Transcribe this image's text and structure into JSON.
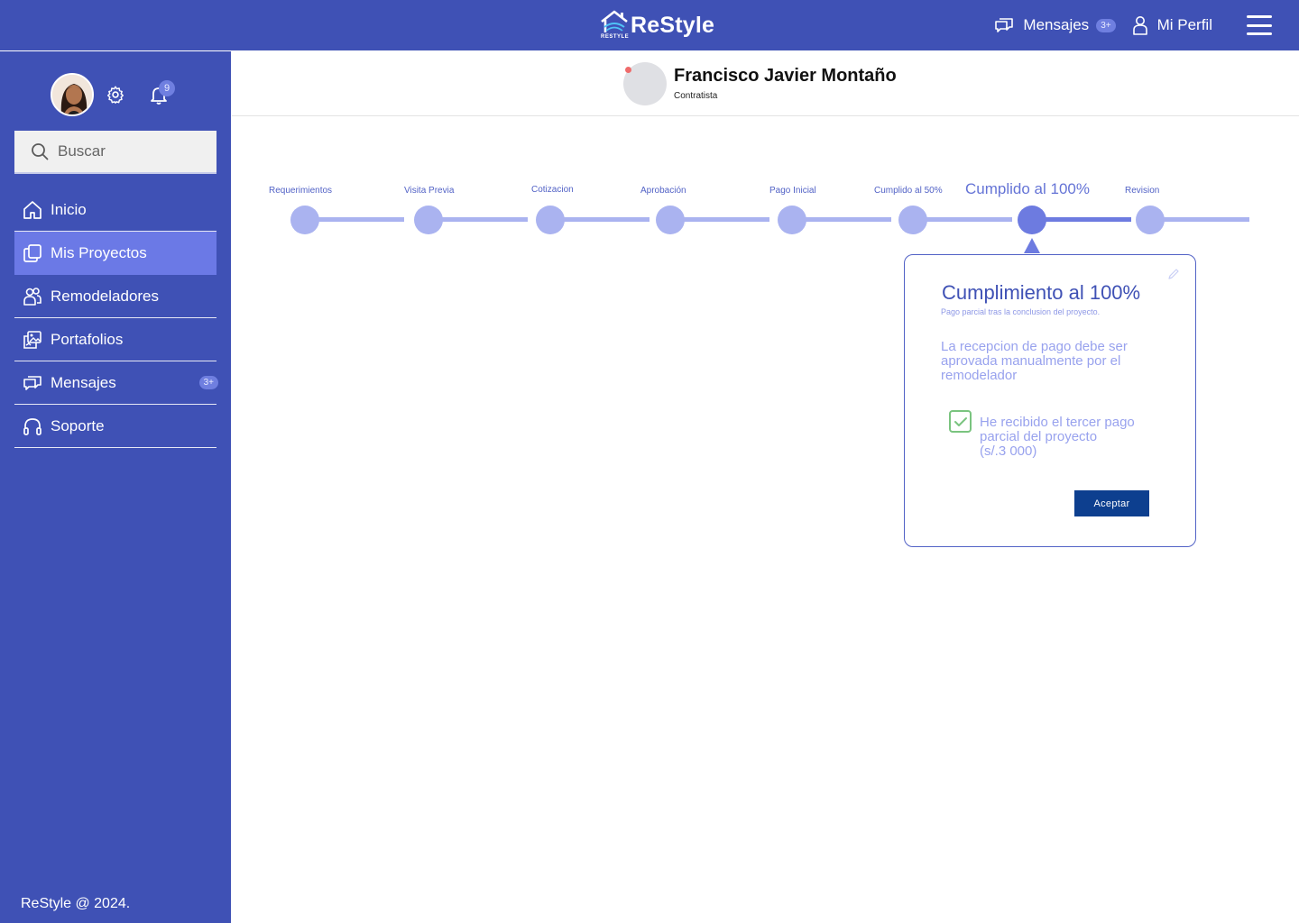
{
  "brand": {
    "name": "ReStyle",
    "sub": "RESTYLE"
  },
  "topnav": {
    "messages_label": "Mensajes",
    "messages_badge": "3+",
    "profile_label": "Mi Perfil"
  },
  "sidebar": {
    "notifications_count": "9",
    "search_placeholder": "Buscar",
    "items": [
      {
        "label": "Inicio",
        "icon": "home-icon"
      },
      {
        "label": "Mis Proyectos",
        "icon": "folders-icon",
        "active": true
      },
      {
        "label": "Remodeladores",
        "icon": "users-icon"
      },
      {
        "label": "Portafolios",
        "icon": "portfolio-icon"
      },
      {
        "label": "Mensajes",
        "icon": "chat-icon",
        "badge": "3+"
      },
      {
        "label": "Soporte",
        "icon": "headset-icon"
      }
    ],
    "footer": "ReStyle @ 2024."
  },
  "profile": {
    "name": "Francisco Javier Montaño",
    "role": "Contratista"
  },
  "steps": [
    {
      "label": "Requerimientos"
    },
    {
      "label": "Visita Previa"
    },
    {
      "label": "Cotizacion"
    },
    {
      "label": "Aprobación"
    },
    {
      "label": "Pago Inicial"
    },
    {
      "label": "Cumplido al 50%"
    },
    {
      "label": "Cumplido al 100%",
      "current": true
    },
    {
      "label": "Revision"
    }
  ],
  "popover": {
    "title": "Cumplimiento al 100%",
    "subtitle": "Pago parcial tras la conclusion del proyecto.",
    "message": "La recepcion de pago debe ser aprovada manualmente por el remodelador",
    "checkbox_checked": true,
    "checkbox_label_line1": "He recibido el tercer pago parcial del proyecto",
    "checkbox_label_line2": "(s/.3 000)",
    "accept_label": "Aceptar"
  },
  "colors": {
    "primary": "#3f51b5",
    "accent": "#6b79e6",
    "step_inactive": "#aab3f0",
    "step_active": "#6d7be0",
    "button": "#0d3f8f",
    "check": "#7ac47f"
  }
}
